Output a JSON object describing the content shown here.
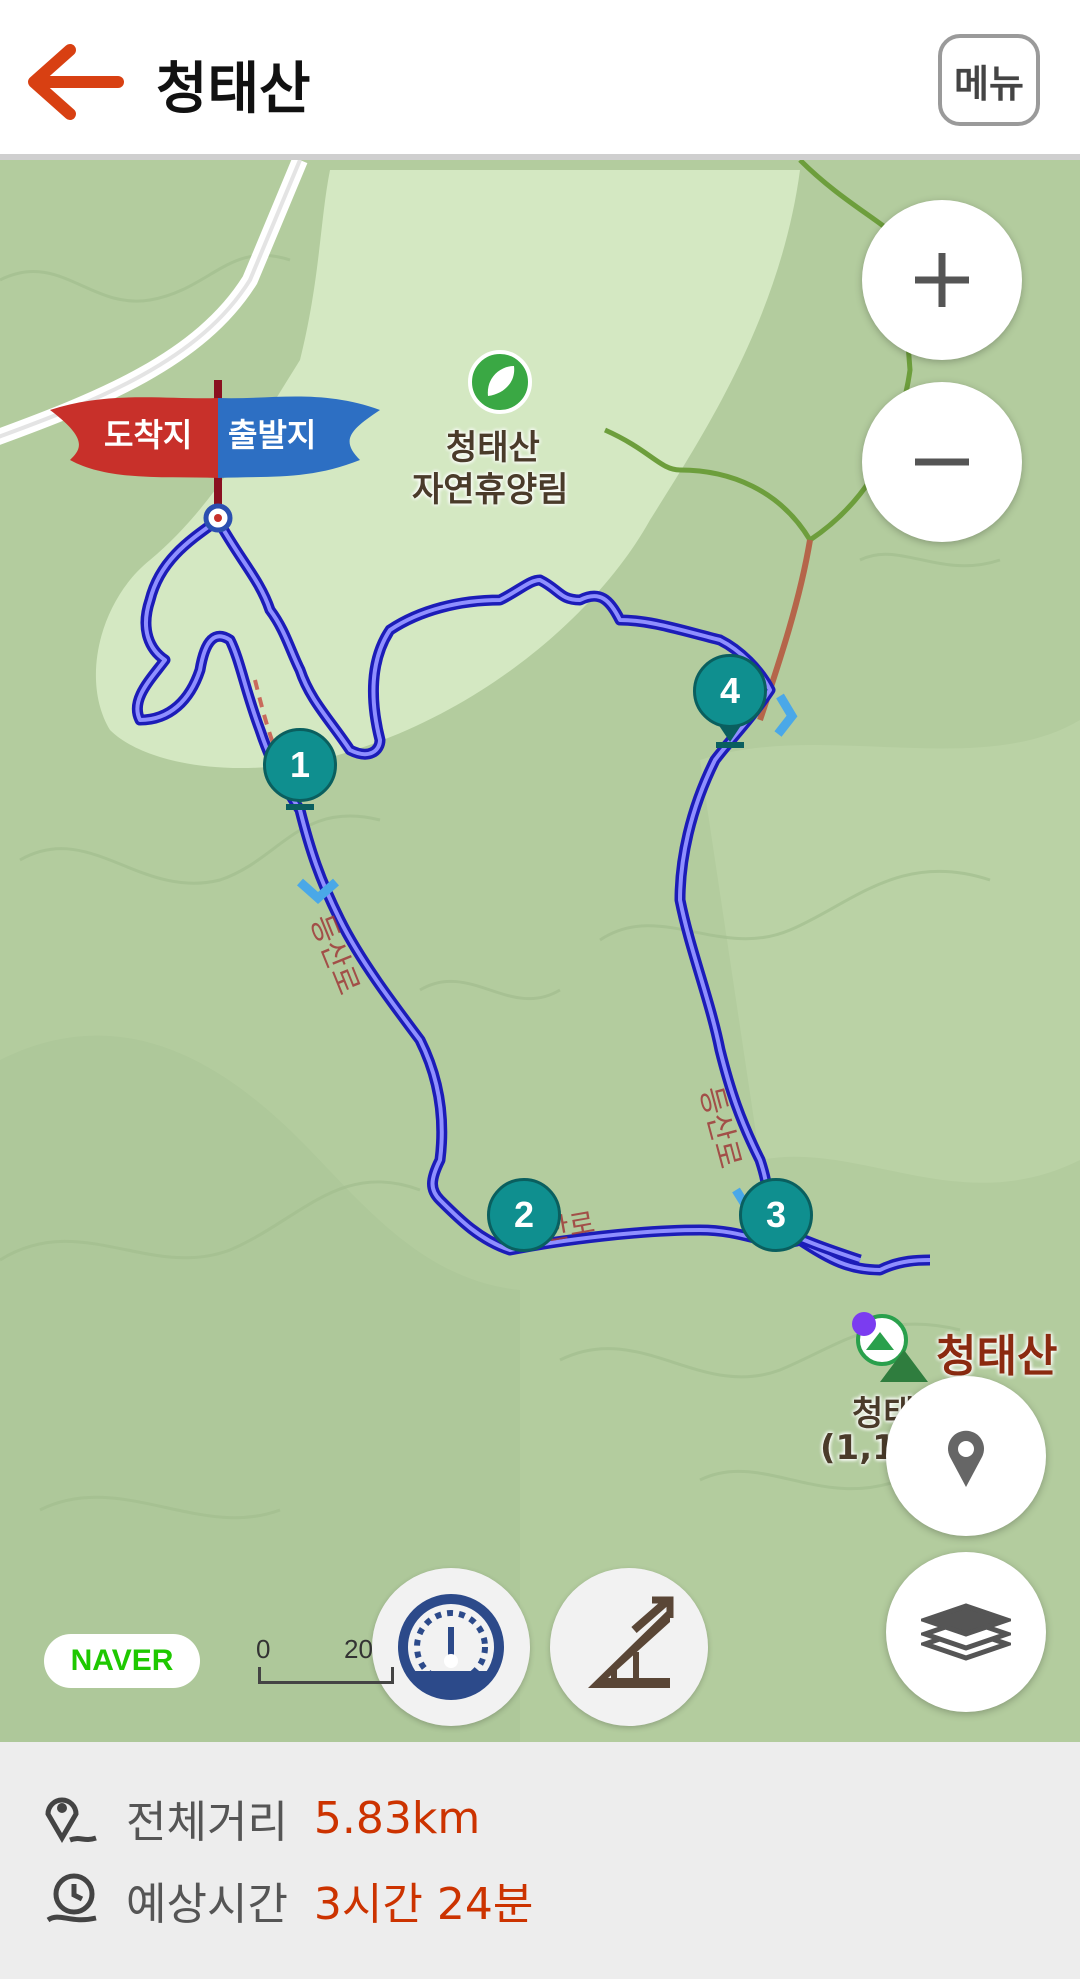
{
  "header": {
    "title": "청태산",
    "menu_label": "메뉴"
  },
  "map": {
    "start_flag_label": "출발지",
    "end_flag_label": "도착지",
    "poi_label_line1": "청태산",
    "poi_label_line2": "자연휴양림",
    "peak_label": "청태산",
    "peak_sub_line1": "청태",
    "peak_sub_line2": "(1,19",
    "waypoints": [
      "1",
      "2",
      "3",
      "4"
    ],
    "naver_badge": "NAVER",
    "scale_min": "0",
    "scale_max": "20"
  },
  "summary": {
    "distance_label": "전체거리",
    "distance_value": "5.83km",
    "time_label": "예상시간",
    "time_value": "3시간 24분"
  },
  "colors": {
    "accent": "#cc3300",
    "route": "#2a2ad6",
    "waypoint": "#0f8f8f"
  }
}
